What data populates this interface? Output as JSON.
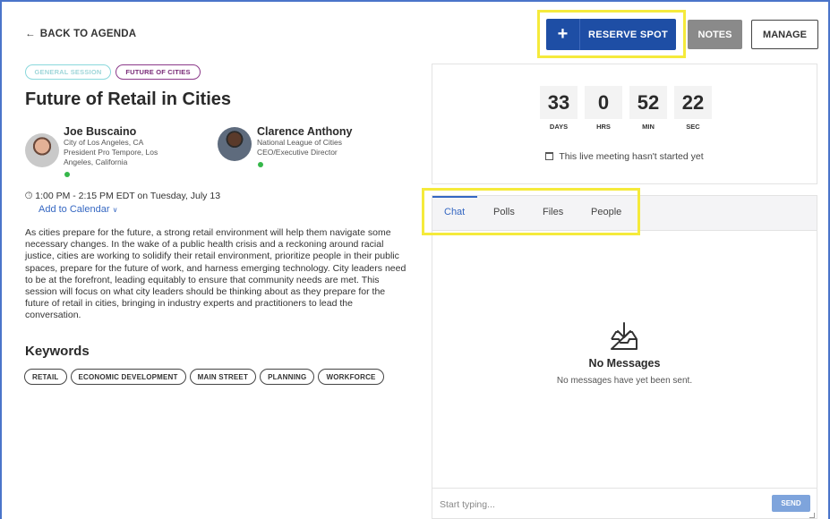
{
  "nav": {
    "back_label": "BACK TO AGENDA",
    "back_icon": "arrow-left-icon"
  },
  "actions": {
    "reserve_label": "RESERVE SPOT",
    "reserve_icon": "plus-icon",
    "notes_label": "NOTES",
    "manage_label": "MANAGE"
  },
  "session": {
    "tags": [
      "GENERAL SESSION",
      "FUTURE OF CITIES"
    ],
    "title": "Future of Retail in Cities",
    "time": "1:00 PM - 2:15 PM EDT on Tuesday, July 13",
    "add_to_calendar": "Add to Calendar",
    "description": "As cities prepare for the future, a strong retail environment will help them navigate some necessary changes. In the wake of a public health crisis and a reckoning around racial justice, cities are working to solidify their retail environment, prioritize people in their public spaces, prepare for the future of work, and harness emerging technology. City leaders need to be at the forefront, leading equitably to ensure that community needs are met. This session will focus on what city leaders should be thinking about as they prepare for the future of retail in cities, bringing in industry experts and practitioners to lead the conversation.",
    "keywords_title": "Keywords",
    "keywords": [
      "RETAIL",
      "ECONOMIC DEVELOPMENT",
      "MAIN STREET",
      "PLANNING",
      "WORKFORCE"
    ]
  },
  "speakers": [
    {
      "name": "Joe Buscaino",
      "line1": "City of Los Angeles, CA",
      "line2": "President Pro Tempore, Los",
      "line3": "Angeles, California"
    },
    {
      "name": "Clarence Anthony",
      "line1": "National League of Cities",
      "line2": "CEO/Executive Director",
      "line3": ""
    }
  ],
  "countdown": {
    "days": "33",
    "hrs": "0",
    "min": "52",
    "sec": "22",
    "days_label": "DAYS",
    "hrs_label": "HRS",
    "min_label": "MIN",
    "sec_label": "SEC",
    "status": "This live meeting hasn't started yet"
  },
  "chat": {
    "tabs": [
      "Chat",
      "Polls",
      "Files",
      "People"
    ],
    "empty_title": "No Messages",
    "empty_subtitle": "No messages have yet been sent.",
    "placeholder": "Start typing...",
    "send_label": "SEND"
  },
  "colors": {
    "primary": "#1e4ea5",
    "link": "#3567c2",
    "highlight": "#f5ea3b",
    "online": "#35b74a"
  }
}
